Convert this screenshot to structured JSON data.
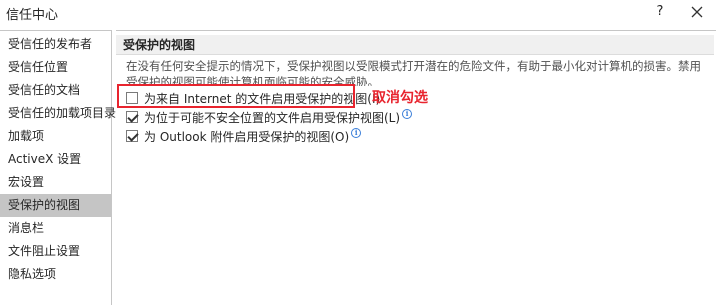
{
  "window": {
    "title": "信任中心",
    "help_label": "?"
  },
  "sidebar": {
    "items": [
      {
        "label": "受信任的发布者"
      },
      {
        "label": "受信任位置"
      },
      {
        "label": "受信任的文档"
      },
      {
        "label": "受信任的加载项目录"
      },
      {
        "label": "加载项"
      },
      {
        "label": "ActiveX 设置"
      },
      {
        "label": "宏设置"
      },
      {
        "label": "受保护的视图",
        "active": true
      },
      {
        "label": "消息栏"
      },
      {
        "label": "文件阻止设置"
      },
      {
        "label": "隐私选项"
      }
    ]
  },
  "main": {
    "section_title": "受保护的视图",
    "description": "在没有任何安全提示的情况下，受保护视图以受限模式打开潜在的危险文件，有助于最小化对计算机的损害。禁用受保护的视图可能使计算机面临可能的安全威胁。",
    "options": [
      {
        "label": "为来自 Internet 的文件启用受保护的视图(I)",
        "checked": false,
        "info": false
      },
      {
        "label": "为位于可能不安全位置的文件启用受保护视图(L)",
        "checked": true,
        "info": true
      },
      {
        "label": "为 Outlook 附件启用受保护的视图(O)",
        "checked": true,
        "info": true
      }
    ]
  },
  "annotation": {
    "text": "取消勾选",
    "color": "#e8242e"
  },
  "icons": {
    "info": "info-icon",
    "close": "close-icon"
  }
}
